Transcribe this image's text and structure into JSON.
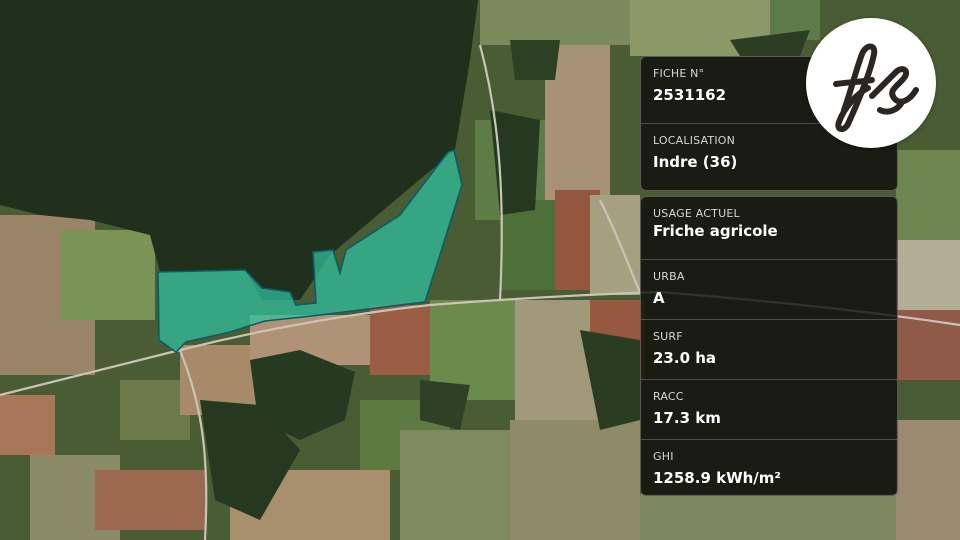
{
  "fiche": {
    "label": "FICHE N°",
    "value": "2531162"
  },
  "localisation": {
    "label": "LOCALISATION",
    "value": "Indre (36)"
  },
  "details": [
    {
      "label": "USAGE ACTUEL",
      "value": "Friche agricole"
    },
    {
      "label": "URBA",
      "value": "A"
    },
    {
      "label": "SURF",
      "value": "23.0 ha"
    },
    {
      "label": "RACC",
      "value": "17.3 km"
    },
    {
      "label": "GHI",
      "value": "1258.9 kWh/m²"
    }
  ],
  "logo": {
    "name": "fs-monogram-logo",
    "color": "#2b2622",
    "background": "#ffffff"
  },
  "parcel": {
    "fill": "#2ec4a0",
    "stroke": "#0e5a6a"
  },
  "colors": {
    "forest": "#20301c",
    "field_light": "#9a9a72",
    "field_green": "#4f6c3a",
    "field_tan": "#a48866",
    "road": "#c9c4b6"
  }
}
